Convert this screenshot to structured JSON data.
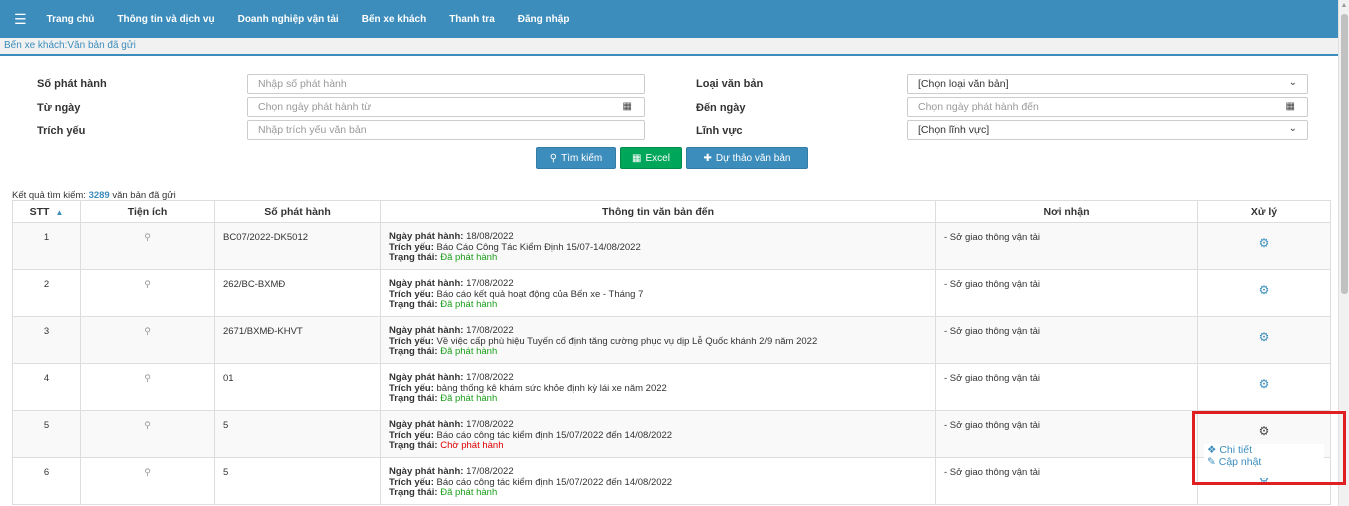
{
  "nav": {
    "menu_icon": "hamburger-icon",
    "items": [
      "Trang chủ",
      "Thông tin và dịch vụ",
      "Doanh nghiệp vận tải",
      "Bến xe khách",
      "Thanh tra",
      "Đăng nhập"
    ]
  },
  "breadcrumb": "Bến xe khách:Văn bản đã gửi",
  "form": {
    "so_phat_hanh": {
      "label": "Số phát hành",
      "placeholder": "Nhập số phát hành"
    },
    "loai_van_ban": {
      "label": "Loại văn bản",
      "value": "[Chọn loại văn bản]"
    },
    "tu_ngay": {
      "label": "Từ ngày",
      "placeholder": "Chọn ngày phát hành từ"
    },
    "den_ngay": {
      "label": "Đến ngày",
      "placeholder": "Chọn ngày phát hành đến"
    },
    "trich_yeu": {
      "label": "Trích yếu",
      "placeholder": "Nhập trích yếu văn bản"
    },
    "linh_vuc": {
      "label": "Lĩnh vực",
      "value": "[Chọn lĩnh vực]"
    }
  },
  "buttons": {
    "search": "Tìm kiếm",
    "excel": "Excel",
    "draft": "Dự thảo văn bản"
  },
  "results": {
    "prefix": "Kết quả tìm kiếm: ",
    "count": "3289",
    "suffix": " văn bản đã gửi"
  },
  "table": {
    "headers": {
      "stt": "STT",
      "tien_ich": "Tiện ích",
      "so_phat_hanh": "Số phát hành",
      "thong_tin": "Thông tin văn bản đến",
      "noi_nhan": "Nơi nhận",
      "xu_ly": "Xử lý"
    },
    "field_labels": {
      "ngay": "Ngày phát hành:",
      "trich_yeu": "Trích yếu:",
      "trang_thai": "Trạng thái:"
    },
    "rows": [
      {
        "stt": "1",
        "so": "BC07/2022-DK5012",
        "ngay": "18/08/2022",
        "trich_yeu": "Báo Cáo Công Tác Kiểm Định 15/07-14/08/2022",
        "trang_thai": "Đã phát hành",
        "noi_nhan": "- Sở giao thông vận tải"
      },
      {
        "stt": "2",
        "so": "262/BC-BXMĐ",
        "ngay": "17/08/2022",
        "trich_yeu": "Báo cáo kết quả hoạt động của Bến xe - Tháng 7",
        "trang_thai": "Đã phát hành",
        "noi_nhan": "- Sở giao thông vận tải"
      },
      {
        "stt": "3",
        "so": "2671/BXMĐ-KHVT",
        "ngay": "17/08/2022",
        "trich_yeu": "Về việc cấp phù hiệu Tuyến cố định tăng cường phục vụ dịp Lễ Quốc khánh 2/9 năm 2022",
        "trang_thai": "Đã phát hành",
        "noi_nhan": "- Sở giao thông vận tải"
      },
      {
        "stt": "4",
        "so": "01",
        "ngay": "17/08/2022",
        "trich_yeu": "bảng thống kê khám sức khỏe định kỳ lái xe năm 2022",
        "trang_thai": "Đã phát hành",
        "noi_nhan": "- Sở giao thông vận tải"
      },
      {
        "stt": "5",
        "so": "5",
        "ngay": "17/08/2022",
        "trich_yeu": "Báo cáo công tác kiểm định 15/07/2022 đến 14/08/2022",
        "trang_thai": "Chờ phát hành",
        "noi_nhan": "- Sở giao thông vận tải"
      },
      {
        "stt": "6",
        "so": "5",
        "ngay": "17/08/2022",
        "trich_yeu": "Báo cáo công tác kiểm định 15/07/2022 đến 14/08/2022",
        "trang_thai": "Đã phát hành",
        "noi_nhan": "- Sở giao thông vận tải"
      }
    ]
  },
  "dropdown": {
    "detail": "Chi tiết",
    "update": "Cập nhật"
  },
  "colors": {
    "primary": "#3c8dbc",
    "success": "#00a65a",
    "status_published": "#1a9e1a",
    "status_pending": "#dd0000",
    "highlight": "#e02020"
  }
}
